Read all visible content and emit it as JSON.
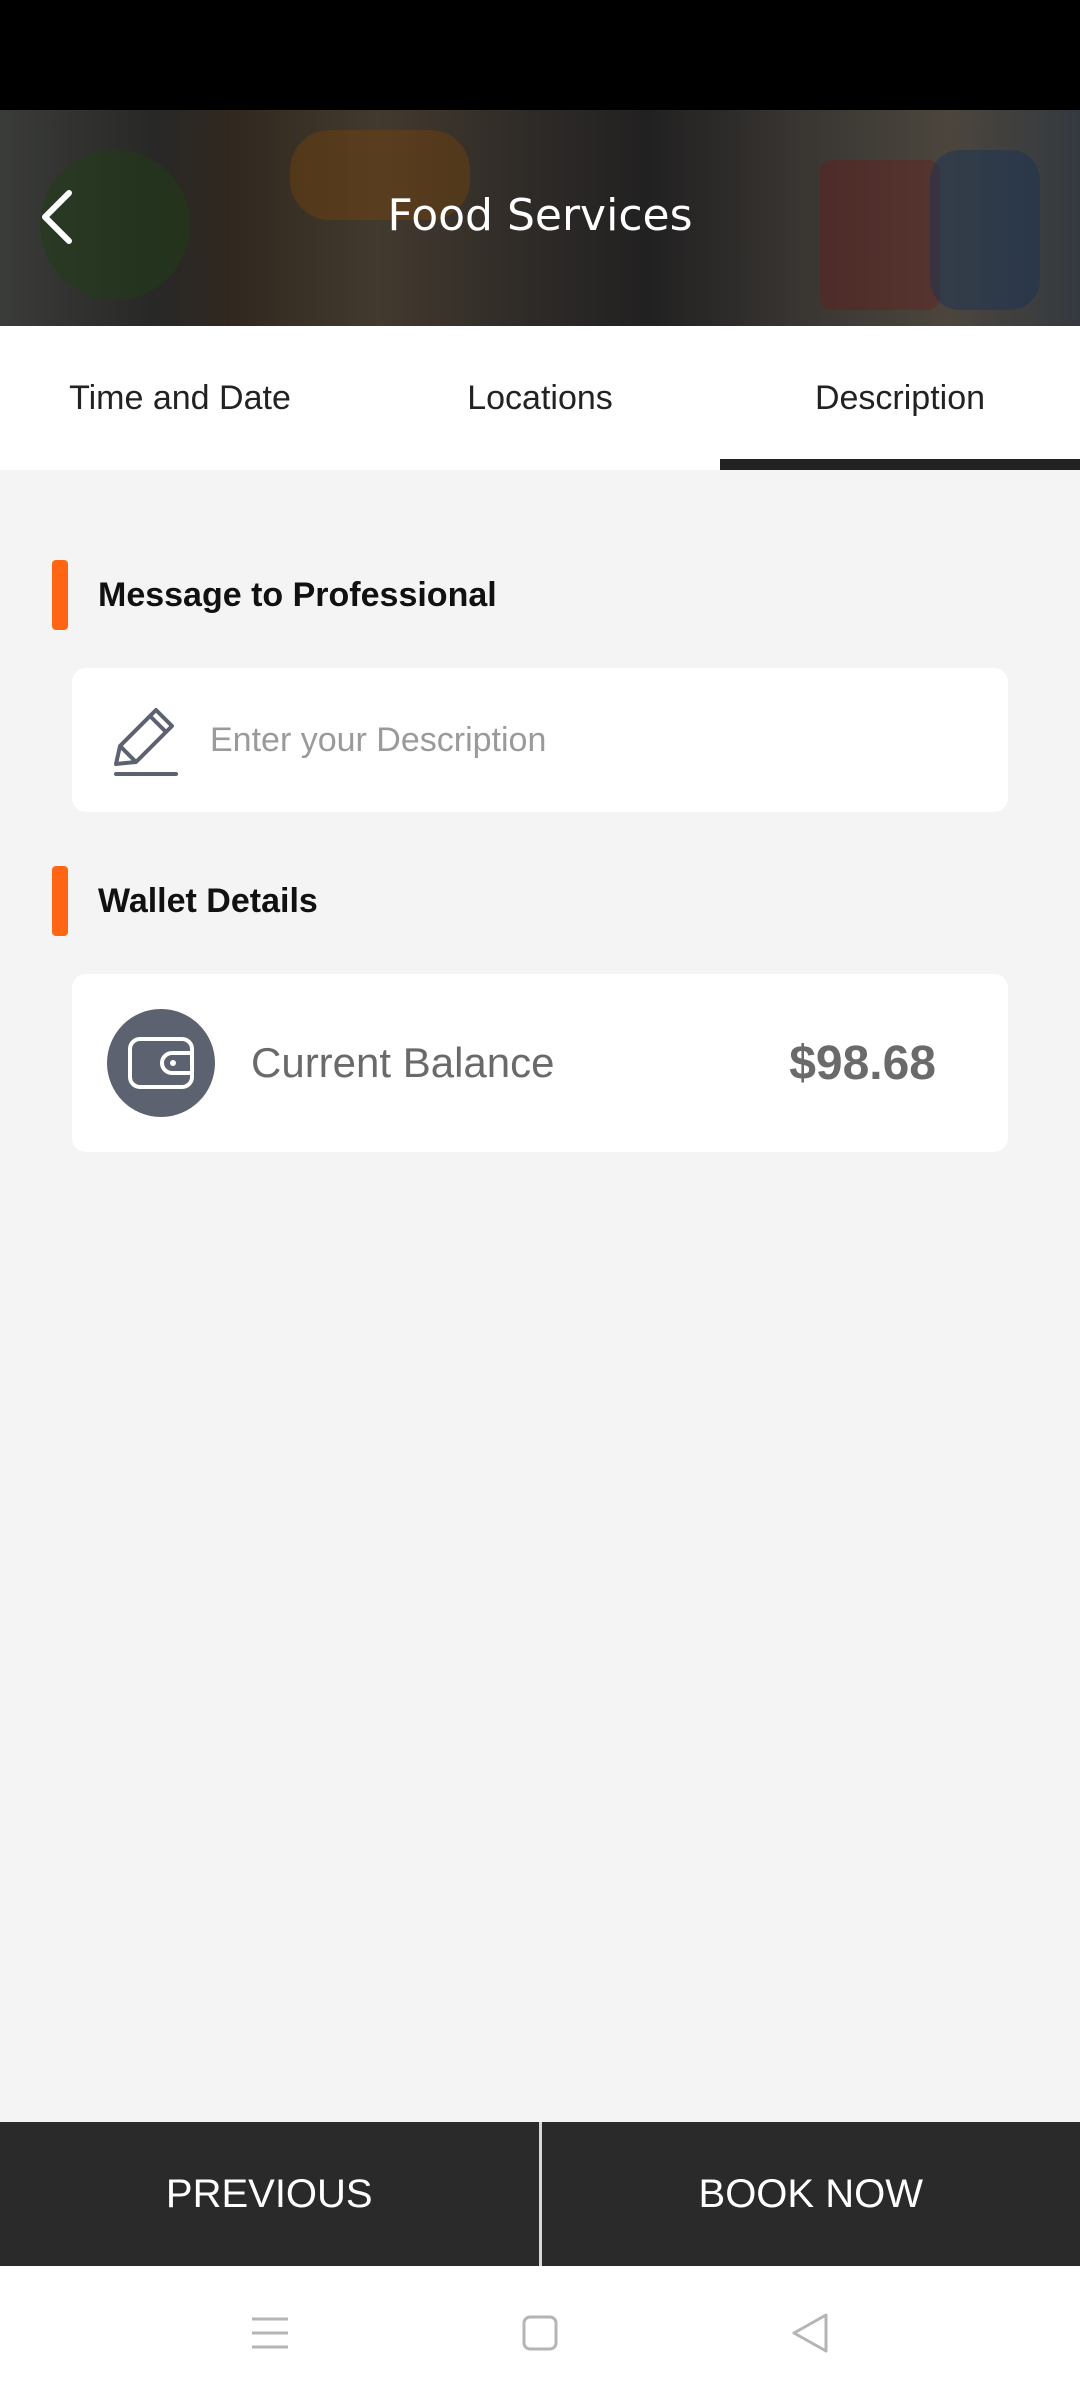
{
  "header": {
    "title": "Food Services"
  },
  "tabs": [
    {
      "label": "Time and Date"
    },
    {
      "label": "Locations"
    },
    {
      "label": "Description"
    }
  ],
  "message_section": {
    "title": "Message to Professional",
    "placeholder": "Enter your Description"
  },
  "wallet_section": {
    "title": "Wallet Details",
    "balance_label": "Current Balance",
    "balance_value": "$98.68"
  },
  "footer": {
    "previous_label": "PREVIOUS",
    "book_label": "BOOK NOW"
  },
  "colors": {
    "accent": "#ff6512",
    "dark": "#2a2a2a",
    "background": "#f4f4f4",
    "wallet_icon_bg": "#5c6270"
  },
  "icons": [
    "back-arrow-icon",
    "pencil-icon",
    "wallet-icon",
    "menu-icon",
    "home-square-icon",
    "back-triangle-icon"
  ]
}
